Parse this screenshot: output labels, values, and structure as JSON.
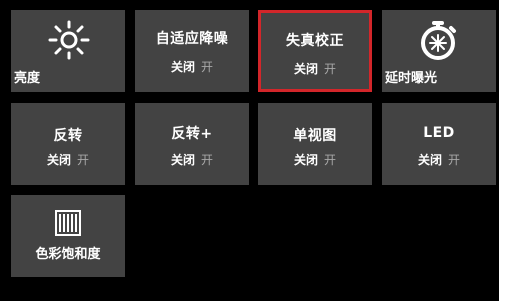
{
  "tiles": [
    {
      "title": "亮度",
      "icon": "brightness-icon"
    },
    {
      "title": "自适应降噪",
      "off": "关闭",
      "on": "开"
    },
    {
      "title": "失真校正",
      "off": "关闭",
      "on": "开"
    },
    {
      "title": "延时曝光",
      "icon": "timer-icon"
    },
    {
      "title": "反转",
      "off": "关闭",
      "on": "开"
    },
    {
      "title": "反转+",
      "off": "关闭",
      "on": "开"
    },
    {
      "title": "单视图",
      "off": "关闭",
      "on": "开"
    },
    {
      "title": "LED",
      "off": "关闭",
      "on": "开"
    },
    {
      "title": "色彩饱和度",
      "icon": "color-bars-icon"
    }
  ],
  "selected_index": 2,
  "colors": {
    "background": "#000000",
    "tile": "#434343",
    "selected_border": "#d3262a",
    "text": "#ffffff",
    "dim_text": "#a8a8a8"
  }
}
